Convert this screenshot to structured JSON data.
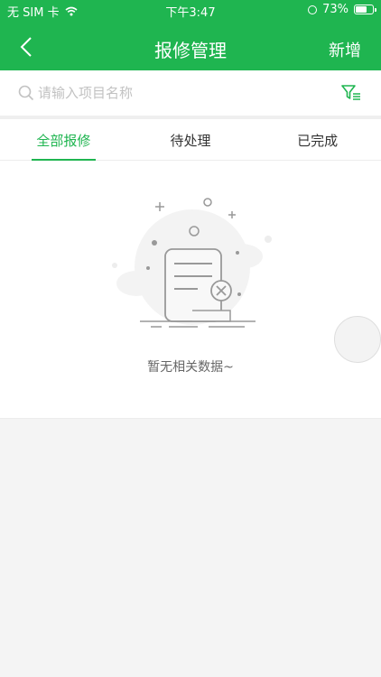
{
  "status_bar": {
    "carrier": "无 SIM 卡",
    "time": "下午3:47",
    "battery": "73%",
    "battery_level": 0.73
  },
  "nav": {
    "title": "报修管理",
    "add_label": "新增"
  },
  "search": {
    "placeholder": "请输入项目名称"
  },
  "tabs": [
    {
      "label": "全部报修",
      "active": true
    },
    {
      "label": "待处理",
      "active": false
    },
    {
      "label": "已完成",
      "active": false
    }
  ],
  "empty": {
    "message": "暂无相关数据~"
  },
  "colors": {
    "accent": "#1fb550"
  }
}
